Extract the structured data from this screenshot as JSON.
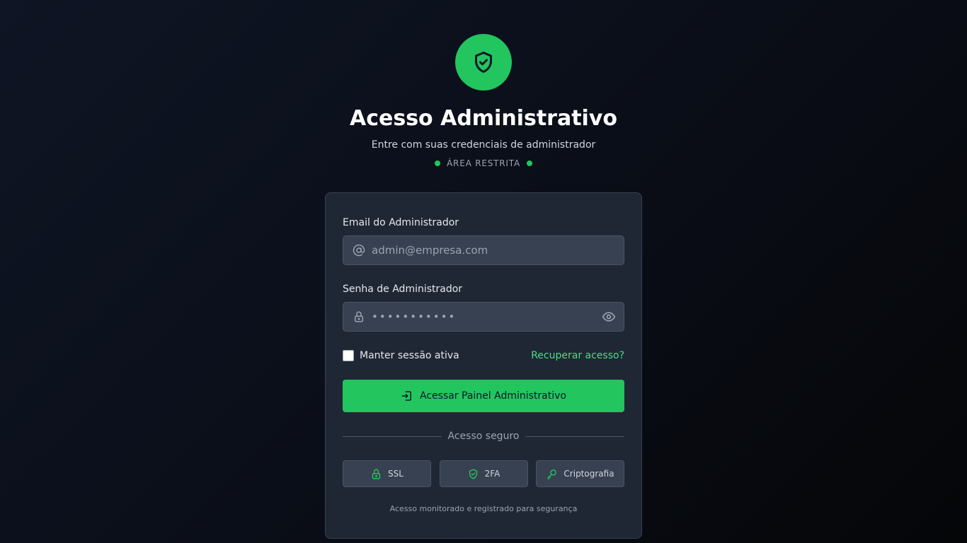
{
  "header": {
    "logo_icon": "shield-check-icon",
    "title": "Acesso Administrativo",
    "subtitle": "Entre com suas credenciais de administrador",
    "badge": "ÁREA RESTRITA"
  },
  "form": {
    "email": {
      "label": "Email do Administrador",
      "placeholder": "admin@empresa.com",
      "value": "",
      "icon": "at-sign-icon"
    },
    "password": {
      "label": "Senha de Administrador",
      "value": "•••••••••••",
      "icon": "lock-icon",
      "toggle_icon": "eye-icon"
    },
    "remember_label": "Manter sessão ativa",
    "remember_checked": false,
    "recover_link": "Recuperar acesso?",
    "submit_label": "Acessar Painel Administrativo",
    "submit_icon": "login-icon"
  },
  "security": {
    "divider_label": "Acesso seguro",
    "badges": [
      {
        "label": "SSL",
        "icon": "lock-icon"
      },
      {
        "label": "2FA",
        "icon": "shield-check-icon"
      },
      {
        "label": "Criptografia",
        "icon": "key-icon"
      }
    ],
    "footnote": "Acesso monitorado e registrado para segurança"
  },
  "colors": {
    "accent": "#22c55e",
    "accent_text": "#4ade80",
    "card_bg": "#1f2735",
    "input_bg": "#374151"
  }
}
